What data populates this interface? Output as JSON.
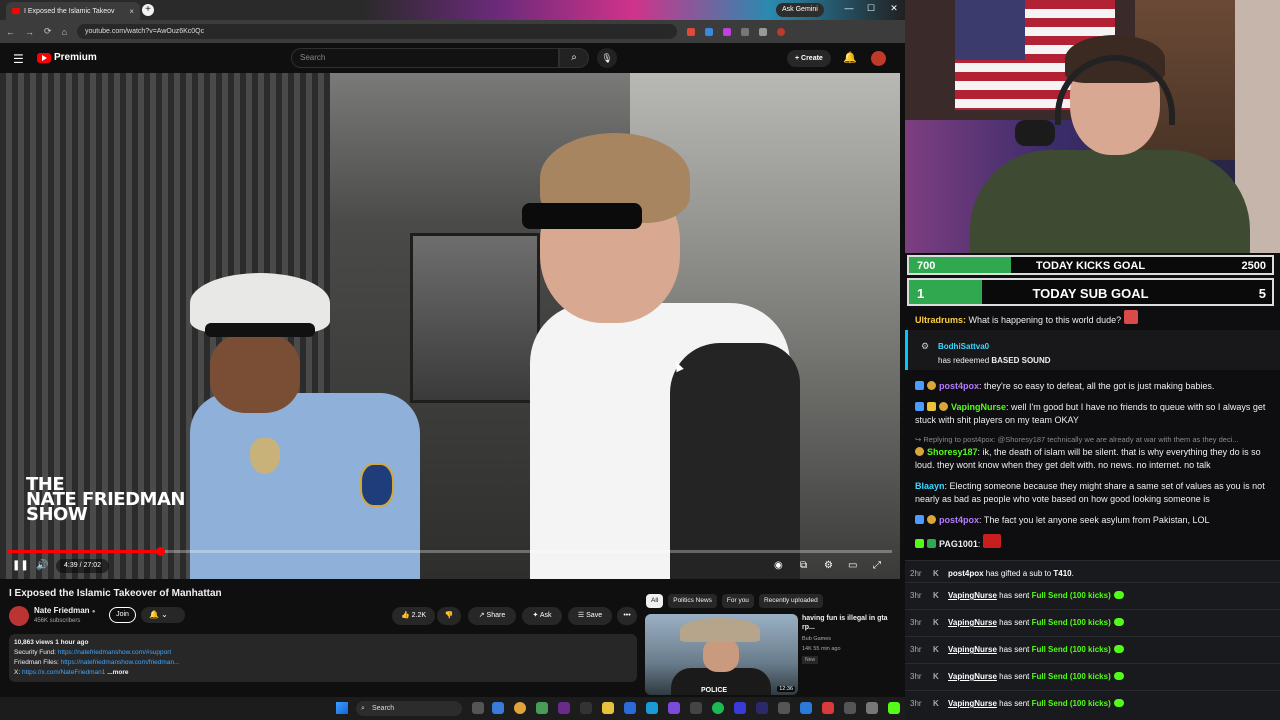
{
  "browser": {
    "tab_title": "I Exposed the Islamic Takeov",
    "tab_close": "×",
    "new_tab": "+",
    "ask_gemini": "Ask Gemini",
    "url": "youtube.com/watch?v=AwOuz6Kc0Qc",
    "controls": {
      "minimize": "—",
      "restore": "☐",
      "close": "✕"
    },
    "nav": {
      "back": "←",
      "forward": "→",
      "reload": "⟳",
      "home": "⌂"
    }
  },
  "youtube": {
    "menu_icon": "☰",
    "logo_text": "Premium",
    "search_placeholder": "Search",
    "search_icon": "⌕",
    "mic_icon": "🎙",
    "create_label": "+ Create",
    "bell_icon": "🔔"
  },
  "video": {
    "watermark_lines": [
      "THE",
      "NATE FRIEDMAN",
      "SHOW"
    ],
    "time": "4:39 / 27:02",
    "progress": 0.172,
    "controls": {
      "pause": "❚❚",
      "volume": "🔊",
      "autoplay": "◉",
      "cc": "⧉",
      "settings": "⚙",
      "miniplayer": "▭",
      "fullscreen": "⤢"
    }
  },
  "below": {
    "title": "I Exposed the Islamic Takeover of Manhattan",
    "channel": "Nate Friedman",
    "verified": "●",
    "subs": "456K subscribers",
    "join": "Join",
    "bell": "🔔 ⌄",
    "like": "👍 2.2K",
    "dislike": "👎",
    "share": "↗ Share",
    "ask": "✦ Ask",
    "save": "☰ Save",
    "more": "•••",
    "desc": {
      "stats": "10,863 views  1 hour ago",
      "line1_label": "Security Fund: ",
      "line1_link": "https://natefriedmanshow.com/#support",
      "line2_label": "Friedman Files: ",
      "line2_link": "https://natefriedmanshow.com/friedman...",
      "line3_label": "X: ",
      "line3_link": "https://x.com/NateFriedman1",
      "more": "...more"
    }
  },
  "recs": {
    "chips": [
      "All",
      "Politics News",
      "For you",
      "Recently uploaded"
    ],
    "item": {
      "title": "having fun is illegal in gta rp...",
      "channel": "Bub Games",
      "meta": "14K  55 min ago",
      "badge": "New",
      "thumb_text": "POLICE",
      "duration": "12:36"
    }
  },
  "taskbar": {
    "search": "Search",
    "search_icon": "⌕"
  },
  "goals": [
    {
      "left": "700",
      "center": "TODAY KICKS GOAL",
      "right": "2500",
      "fraction": 0.28
    },
    {
      "left": "1",
      "center": "TODAY SUB GOAL",
      "right": "5",
      "fraction": 0.2
    }
  ],
  "chat": {
    "m1_user": "Ultradrums:",
    "m1_text": " What is happening to this world dude?",
    "redeem_icon": "⚙",
    "redeem_user": "BodhiSattva0",
    "redeem_text_1": "has redeemed ",
    "redeem_text_2": "BASED SOUND",
    "m2_user": "post4pox",
    "m2_text": ": they're so easy to defeat, all the got is just making babies.",
    "m3_user": "VapingNurse",
    "m3_text": ": well I'm good but I have no friends to queue with so I always get stuck with shit players on my team OKAY",
    "reply_text": "↪ Replying to post4pox: @Shoresy187 technically we are already at war with them as they deci...",
    "m4_user": "Shoresy187",
    "m4_text": ": ik, the death of islam will be silent. that is why everything they do is so loud. they wont know when they get delt with. no news. no internet. no talk",
    "m5_user": "Blaayn",
    "m5_text": ": Electing someone because they might share a same set of values as you is not nearly as bad as people who vote based on how good looking someone is",
    "m6_user": "post4pox",
    "m6_text": ": The fact you let anyone seek asylum from Pakistan, LOL",
    "m7_user": "PAG1001",
    "m7_text": ":"
  },
  "events": [
    {
      "time": "2hr",
      "kick": "K",
      "name": "post4pox",
      "mid": " has gifted a sub to ",
      "target": "T410",
      "end": "."
    },
    {
      "time": "3hr",
      "kick": "K",
      "name": "VapingNurse",
      "mid": " has sent ",
      "gift": "Full Send (100 kicks)"
    },
    {
      "time": "3hr",
      "kick": "K",
      "name": "VapingNurse",
      "mid": " has sent ",
      "gift": "Full Send (100 kicks)"
    },
    {
      "time": "3hr",
      "kick": "K",
      "name": "VapingNurse",
      "mid": " has sent ",
      "gift": "Full Send (100 kicks)"
    },
    {
      "time": "3hr",
      "kick": "K",
      "name": "VapingNurse",
      "mid": " has sent ",
      "gift": "Full Send (100 kicks)"
    },
    {
      "time": "3hr",
      "kick": "K",
      "name": "VapingNurse",
      "mid": " has sent ",
      "gift": "Full Send (100 kicks)"
    }
  ],
  "colors": {
    "accent_red": "#ff0000",
    "kick_green": "#53fc18",
    "goal_green": "#2fa84f",
    "chat_purple": "#b57cff",
    "chat_green": "#53fc18",
    "chat_cyan": "#3fd7ff",
    "chat_gold": "#ffcf40",
    "chat_blue": "#4c9bff"
  }
}
